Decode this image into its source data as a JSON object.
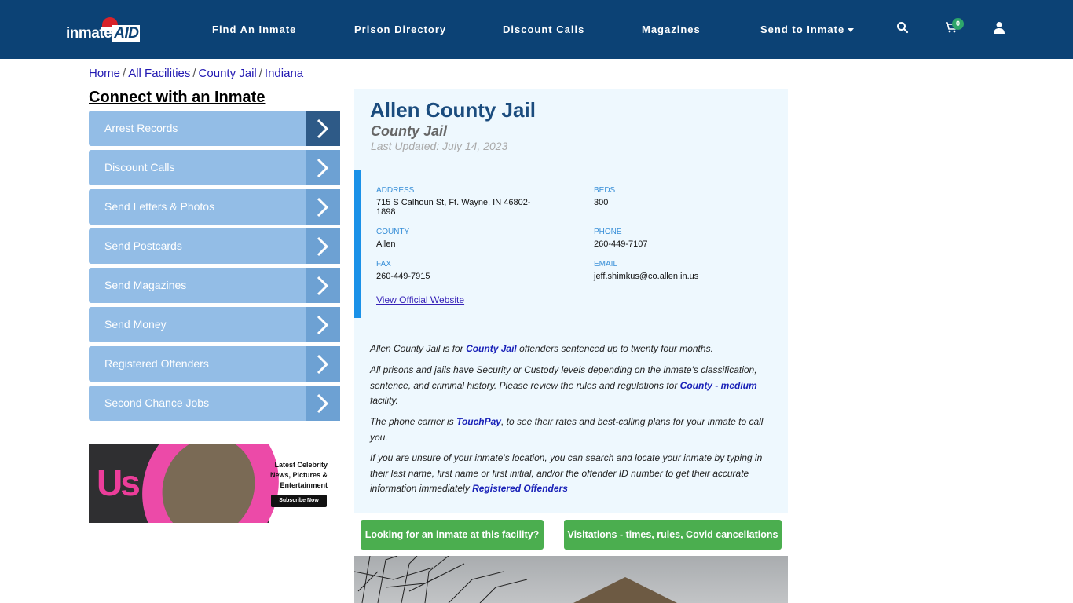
{
  "header": {
    "logo_text": "inmate",
    "logo_accent": "AID",
    "nav": [
      {
        "label": "Find An Inmate"
      },
      {
        "label": "Prison Directory"
      },
      {
        "label": "Discount Calls"
      },
      {
        "label": "Magazines"
      },
      {
        "label": "Send to Inmate",
        "has_dropdown": true
      }
    ],
    "icons": [
      "search-icon",
      "cart-icon",
      "user-icon"
    ],
    "cart_count": "0"
  },
  "breadcrumb": [
    {
      "label": "Home"
    },
    {
      "label": "All Facilities"
    },
    {
      "label": "County Jail"
    },
    {
      "label": "Indiana"
    }
  ],
  "breadcrumb_sep": "/",
  "sidebar": {
    "title": "Connect with an Inmate",
    "items": [
      {
        "label": "Arrest Records"
      },
      {
        "label": "Discount Calls"
      },
      {
        "label": "Send Letters & Photos"
      },
      {
        "label": "Send Postcards"
      },
      {
        "label": "Send Magazines"
      },
      {
        "label": "Send Money"
      },
      {
        "label": "Registered Offenders"
      },
      {
        "label": "Second Chance Jobs"
      }
    ],
    "ad": {
      "brand": "Us",
      "tagline": "Latest Celebrity News, Pictures & Entertainment",
      "cta": "Subscribe Now"
    }
  },
  "facility": {
    "name": "Allen County Jail",
    "type": "County Jail",
    "last_updated": "Last Updated: July 14, 2023",
    "fields": {
      "address_label": "ADDRESS",
      "address": "715 S Calhoun St, Ft. Wayne, IN 46802-1898",
      "beds_label": "BEDS",
      "beds": "300",
      "county_label": "COUNTY",
      "county": "Allen",
      "phone_label": "PHONE",
      "phone": "260-449-7107",
      "fax_label": "FAX",
      "fax": "260-449-7915",
      "email_label": "EMAIL",
      "email": "jeff.shimkus@co.allen.in.us"
    },
    "website_link": "View Official Website",
    "paragraphs": {
      "p1_a": "Allen County Jail is for ",
      "p1_link": "County Jail",
      "p1_b": " offenders sentenced up to twenty four months.",
      "p2_a": "All prisons and jails have Security or Custody levels depending on the inmate's classification, sentence, and criminal history. Please review the rules and regulations for ",
      "p2_link": "County - medium",
      "p2_b": " facility.",
      "p3_a": "The phone carrier is ",
      "p3_link": "TouchPay",
      "p3_b": ", to see their rates and best-calling plans for your inmate to call you.",
      "p4_a": "If you are unsure of your inmate's location, you can search and locate your inmate by typing in their last name, first name or first initial, and/or the offender ID number to get their accurate information immediately ",
      "p4_link": "Registered Offenders"
    },
    "buttons": {
      "find_inmate": "Looking for an inmate at this facility?",
      "visitations": "Visitations - times, rules, Covid cancellations"
    }
  },
  "colors": {
    "header_bg": "#0c4275",
    "sidebar_item": "#93bde6",
    "sidebar_arrow": "#6da1d3",
    "accent_bar": "#1a91e8",
    "green_button": "#4bae4f",
    "card_bg": "#eef8fe"
  }
}
